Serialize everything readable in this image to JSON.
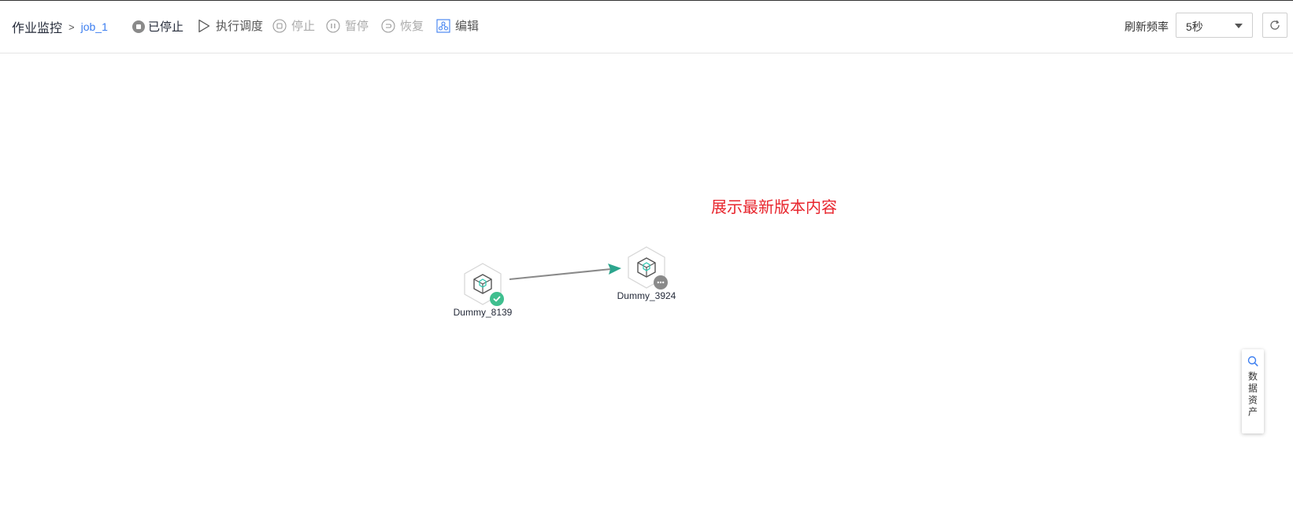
{
  "breadcrumb": {
    "root": "作业监控",
    "separator": ">",
    "current": "job_1"
  },
  "status": {
    "label": "已停止"
  },
  "toolbar": {
    "execute_label": "执行调度",
    "stop_label": "停止",
    "pause_label": "暂停",
    "resume_label": "恢复",
    "edit_label": "编辑"
  },
  "refresh": {
    "label": "刷新频率",
    "value": "5秒"
  },
  "canvas": {
    "notice": "展示最新版本内容",
    "nodes": [
      {
        "name": "Dummy_8139",
        "status": "success"
      },
      {
        "name": "Dummy_3924",
        "status": "pending"
      }
    ]
  },
  "side_panel": {
    "label": "数据资产"
  },
  "colors": {
    "link": "#3c7ef0",
    "success": "#3fbf8f",
    "notice": "#e8262e",
    "edge": "#8a8a8a",
    "arrow": "#2ca58d"
  }
}
